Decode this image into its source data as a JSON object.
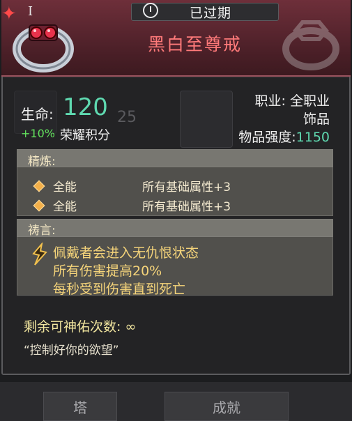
{
  "header": {
    "status": "已过期",
    "item_name": "黑白至尊戒",
    "tier": "I",
    "status_icon": "timer-icon",
    "star_icon": "star-badge-icon"
  },
  "stats": {
    "hp_label": "生命:",
    "hp_value": "120",
    "hp_ghost": "25",
    "honor_pct": "+10%",
    "honor_label": "荣耀积分",
    "class_label": "职业: 全职业",
    "item_type": "饰品",
    "power_label": "物品强度:",
    "power_value": "1150"
  },
  "refine": {
    "title": "精炼:",
    "rows": [
      {
        "name": "全能",
        "attr": "所有基础属性+3"
      },
      {
        "name": "全能",
        "attr": "所有基础属性+3"
      }
    ]
  },
  "prayer": {
    "title": "祷言:",
    "lines": [
      "佩戴者会进入无仇恨状态",
      "所有伤害提高20%",
      "每秒受到伤害直到死亡"
    ]
  },
  "footer": {
    "bless": "剩余可神佑次数: ∞",
    "quote": "“控制好你的欲望”"
  },
  "background_tabs": [
    "塔",
    "成就"
  ],
  "colors": {
    "accent_green": "#5fd9b0",
    "name_red": "#ff7a7a",
    "prayer_gold": "#f5d47a"
  }
}
